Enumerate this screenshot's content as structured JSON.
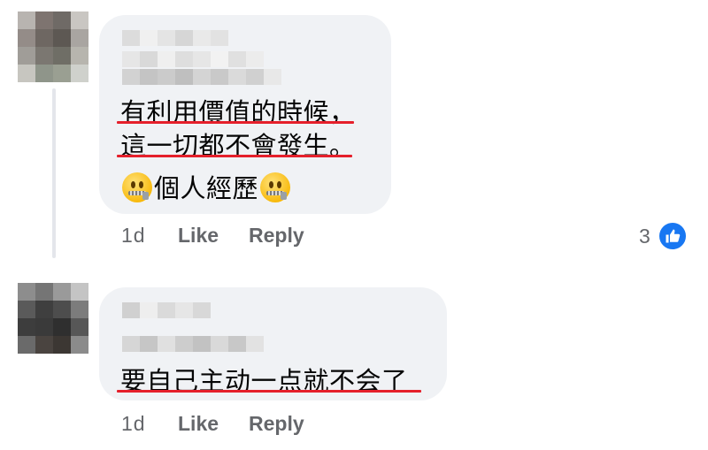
{
  "comments": [
    {
      "lines": [
        "有利用價值的時候，",
        "這一切都不會發生。"
      ],
      "last_line": {
        "emoji_left": "zipper-mouth-face",
        "text": "個人經歷",
        "emoji_right": "zipper-mouth-face"
      },
      "time": "1d",
      "like_label": "Like",
      "reply_label": "Reply",
      "reaction_count": "3",
      "reaction_icon": "thumbs-up-icon"
    },
    {
      "lines": [
        "要自己主动一点就不会了"
      ],
      "time": "1d",
      "like_label": "Like",
      "reply_label": "Reply"
    }
  ],
  "colors": {
    "bubble": "#f0f2f5",
    "underline": "#e5202b",
    "like_blue": "#1877f2",
    "meta_text": "#65676b"
  }
}
